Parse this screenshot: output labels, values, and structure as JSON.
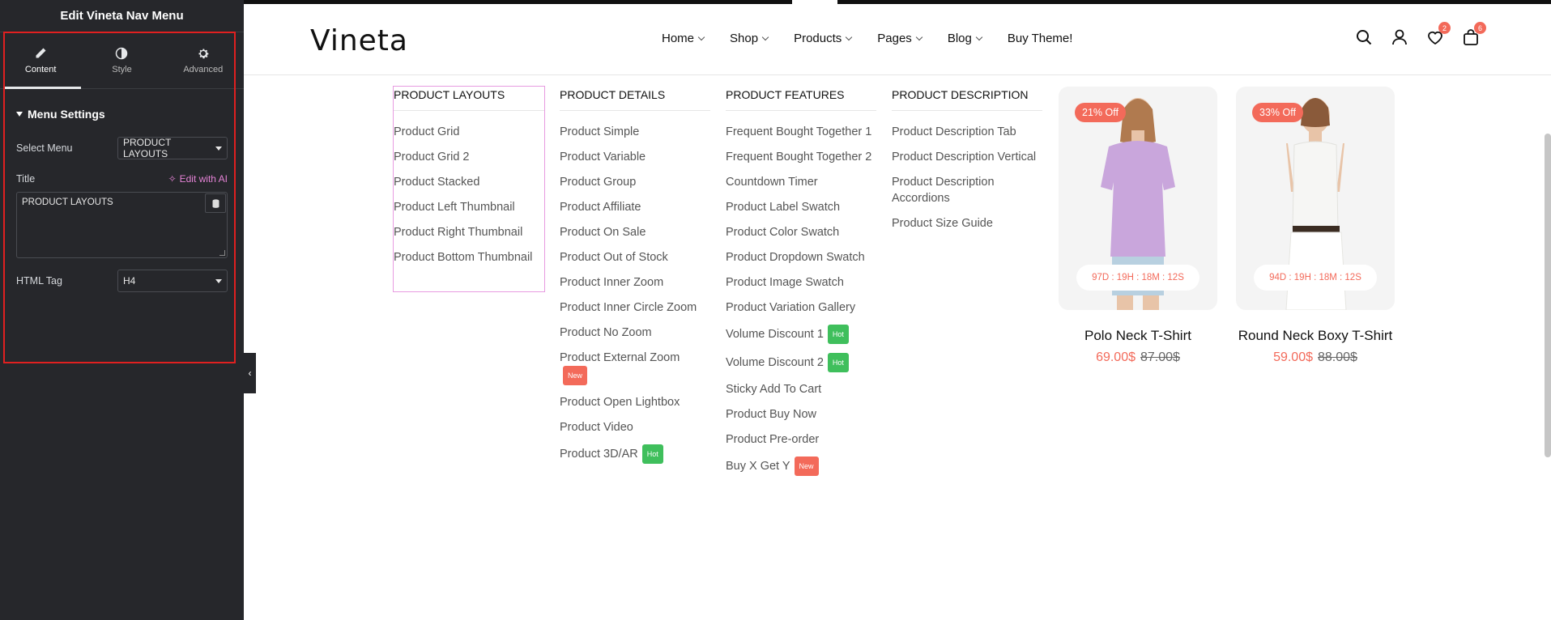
{
  "editor": {
    "title": "Edit Vineta Nav Menu",
    "tabs": [
      {
        "label": "Content",
        "icon": "pencil-icon",
        "active": true
      },
      {
        "label": "Style",
        "icon": "contrast-icon",
        "active": false
      },
      {
        "label": "Advanced",
        "icon": "gear-icon",
        "active": false
      }
    ],
    "section": "Menu Settings",
    "select_menu_label": "Select Menu",
    "select_menu_value": "PRODUCT LAYOUTS",
    "title_label": "Title",
    "edit_ai_label": "Edit with AI",
    "title_value": "PRODUCT LAYOUTS",
    "html_tag_label": "HTML Tag",
    "html_tag_value": "H4"
  },
  "site": {
    "logo": "Vineta",
    "nav": [
      "Home",
      "Shop",
      "Products",
      "Pages",
      "Blog",
      "Buy Theme!"
    ],
    "wishlist_count": "2",
    "cart_count": "6"
  },
  "mega_menu": {
    "columns": [
      {
        "heading": "PRODUCT LAYOUTS",
        "items": [
          {
            "label": "Product Grid"
          },
          {
            "label": "Product Grid 2"
          },
          {
            "label": "Product Stacked"
          },
          {
            "label": "Product Left Thumbnail"
          },
          {
            "label": "Product Right Thumbnail"
          },
          {
            "label": "Product Bottom Thumbnail"
          }
        ]
      },
      {
        "heading": "PRODUCT DETAILS",
        "items": [
          {
            "label": "Product Simple"
          },
          {
            "label": "Product Variable"
          },
          {
            "label": "Product Group"
          },
          {
            "label": "Product Affiliate"
          },
          {
            "label": "Product On Sale"
          },
          {
            "label": "Product Out of Stock"
          },
          {
            "label": "Product Inner Zoom"
          },
          {
            "label": "Product Inner Circle Zoom"
          },
          {
            "label": "Product No Zoom"
          },
          {
            "label": "Product External Zoom",
            "tag": "New"
          },
          {
            "label": "Product Open Lightbox"
          },
          {
            "label": "Product Video"
          },
          {
            "label": "Product 3D/AR",
            "tag": "Hot"
          }
        ]
      },
      {
        "heading": "PRODUCT FEATURES",
        "items": [
          {
            "label": "Frequent Bought Together 1"
          },
          {
            "label": "Frequent Bought Together 2"
          },
          {
            "label": "Countdown Timer"
          },
          {
            "label": "Product Label Swatch"
          },
          {
            "label": "Product Color Swatch"
          },
          {
            "label": "Product Dropdown Swatch"
          },
          {
            "label": "Product Image Swatch"
          },
          {
            "label": "Product Variation Gallery"
          },
          {
            "label": "Volume Discount 1",
            "tag": "Hot"
          },
          {
            "label": "Volume Discount 2",
            "tag": "Hot"
          },
          {
            "label": "Sticky Add To Cart"
          },
          {
            "label": "Product Buy Now"
          },
          {
            "label": "Product Pre-order"
          },
          {
            "label": "Buy X Get Y",
            "tag": "New"
          }
        ]
      },
      {
        "heading": "PRODUCT DESCRIPTION",
        "items": [
          {
            "label": "Product Description Tab"
          },
          {
            "label": "Product Description Vertical"
          },
          {
            "label": "Product Description Accordions"
          },
          {
            "label": "Product Size Guide"
          }
        ]
      }
    ]
  },
  "products": [
    {
      "sale": "21% Off",
      "timer": "97D : 19H : 18M : 12S",
      "name": "Polo Neck T-Shirt",
      "price": "69.00$",
      "old_price": "87.00$",
      "shirt_color": "#c9a6dc",
      "pants_color": "#b8d0e0"
    },
    {
      "sale": "33% Off",
      "timer": "94D : 19H : 18M : 12S",
      "name": "Round Neck Boxy T-Shirt",
      "price": "59.00$",
      "old_price": "88.00$",
      "shirt_color": "#f6f6f4",
      "pants_color": "#ffffff"
    }
  ]
}
